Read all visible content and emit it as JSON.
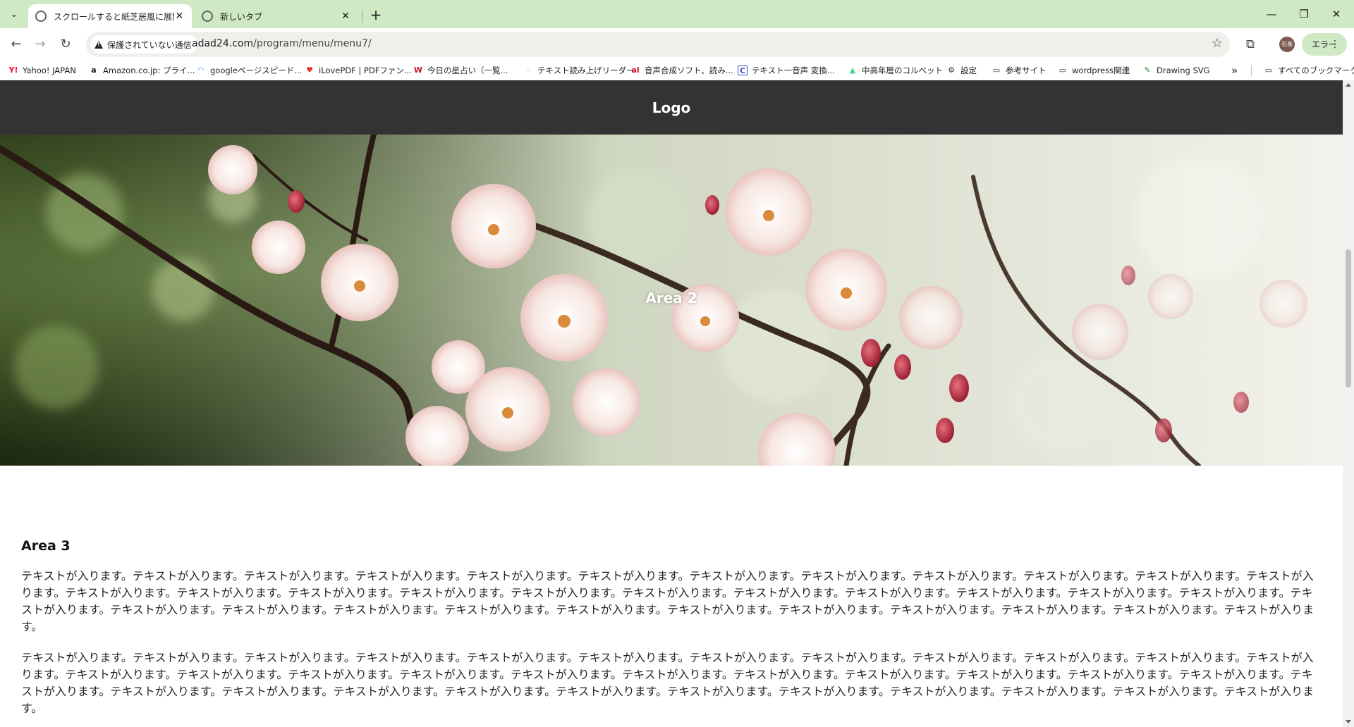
{
  "browser": {
    "tabs": [
      {
        "title": "スクロールすると紙芝居風に展開",
        "active": true
      },
      {
        "title": "新しいタブ",
        "active": false
      }
    ],
    "new_tab_label": "+",
    "security_chip": "保護されていない通信",
    "url_host": "adad24.com",
    "url_path": "/program/menu/menu7/",
    "profile_initials": "石島",
    "error_pill_label": "エラー",
    "bookmarks": [
      {
        "label": "Yahoo! JAPAN",
        "icon": "yahoo-icon"
      },
      {
        "label": "Amazon.co.jp: プライ...",
        "icon": "amazon-icon"
      },
      {
        "label": "googleページスピード...",
        "icon": "pagespeed-icon"
      },
      {
        "label": "iLovePDF | PDFファン...",
        "icon": "heart-icon"
      },
      {
        "label": "今日の星占い（一覧...",
        "icon": "horoscope-icon"
      },
      {
        "label": "テキスト読み上げリーダー",
        "icon": "reader-icon"
      },
      {
        "label": "音声合成ソフト、読み...",
        "icon": "ai-icon"
      },
      {
        "label": "テキスト一音声 変換...",
        "icon": "text-speech-icon"
      },
      {
        "label": "中高年層のコルベット",
        "icon": "android-icon"
      },
      {
        "label": "設定",
        "icon": "gear-icon"
      },
      {
        "label": "参考サイト",
        "icon": "folder-icon"
      },
      {
        "label": "wordpress関連",
        "icon": "folder-icon"
      },
      {
        "label": "Drawing SVG",
        "icon": "svg-icon"
      }
    ],
    "bookmarks_more": "»",
    "all_bookmarks": "すべてのブックマーク"
  },
  "page": {
    "logo": "Logo",
    "hero_label": "Area 2",
    "area3_title": "Area 3",
    "paragraphs": [
      "テキストが入ります。テキストが入ります。テキストが入ります。テキストが入ります。テキストが入ります。テキストが入ります。テキストが入ります。テキストが入ります。テキストが入ります。テキストが入ります。テキストが入ります。テキストが入ります。テキストが入ります。テキストが入ります。テキストが入ります。テキストが入ります。テキストが入ります。テキストが入ります。テキストが入ります。テキストが入ります。テキストが入ります。テキストが入ります。テキストが入ります。テキストが入ります。テキストが入ります。テキストが入ります。テキストが入ります。テキストが入ります。テキストが入ります。テキストが入ります。テキストが入ります。テキストが入ります。テキストが入ります。テキストが入ります。テキストが入ります。",
      "テキストが入ります。テキストが入ります。テキストが入ります。テキストが入ります。テキストが入ります。テキストが入ります。テキストが入ります。テキストが入ります。テキストが入ります。テキストが入ります。テキストが入ります。テキストが入ります。テキストが入ります。テキストが入ります。テキストが入ります。テキストが入ります。テキストが入ります。テキストが入ります。テキストが入ります。テキストが入ります。テキストが入ります。テキストが入ります。テキストが入ります。テキストが入ります。テキストが入ります。テキストが入ります。テキストが入ります。テキストが入ります。テキストが入ります。テキストが入ります。テキストが入ります。テキストが入ります。テキストが入ります。テキストが入ります。テキストが入ります。"
    ]
  },
  "colors": {
    "tabstrip": "#cfe9c4",
    "header_bg": "#333333",
    "text": "#222222"
  }
}
